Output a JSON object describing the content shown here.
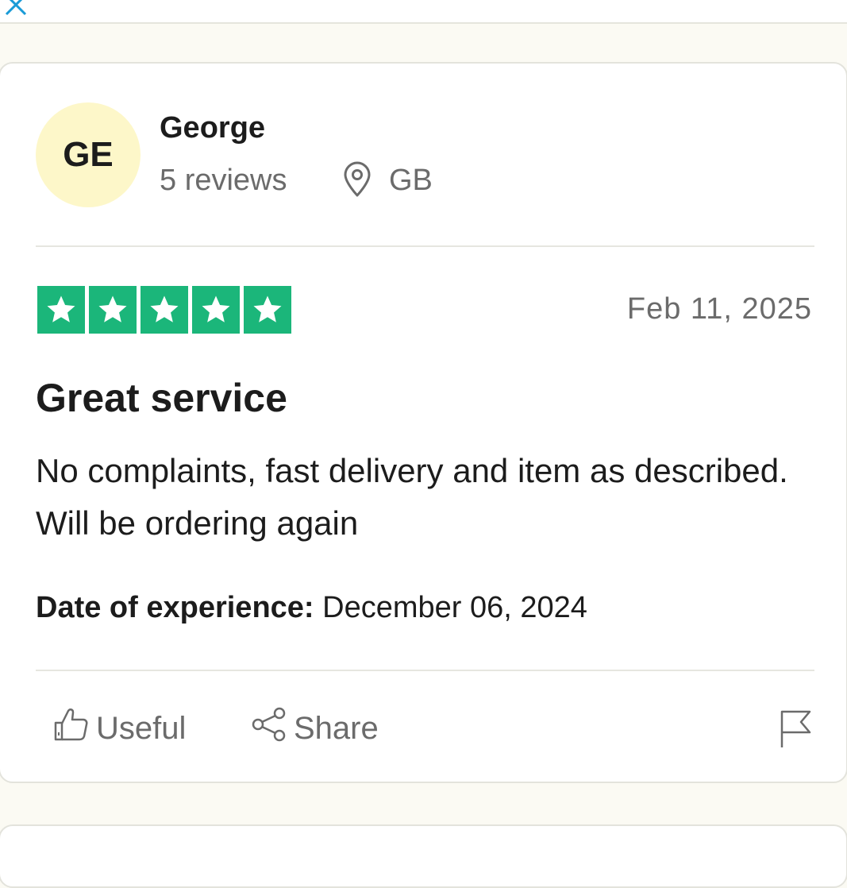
{
  "reviewer": {
    "initials": "GE",
    "name": "George",
    "review_count": "5 reviews",
    "country": "GB"
  },
  "review": {
    "rating": 5,
    "max_rating": 5,
    "date": "Feb 11, 2025",
    "title": "Great service",
    "body": "No complaints, fast delivery and item as described. Will be ordering again",
    "experience_label": "Date of experience:",
    "experience_date": "December 06, 2024"
  },
  "actions": {
    "useful_label": "Useful",
    "share_label": "Share"
  },
  "icons": {
    "close": "close-icon",
    "location": "location-pin-icon",
    "star": "star-icon",
    "thumbs_up": "thumbs-up-icon",
    "share": "share-icon",
    "flag": "flag-icon"
  },
  "colors": {
    "star_green": "#1bb67a",
    "avatar_bg": "#fdf7c9",
    "muted_text": "#6b6b6b",
    "close_blue": "#1a9bd7"
  }
}
